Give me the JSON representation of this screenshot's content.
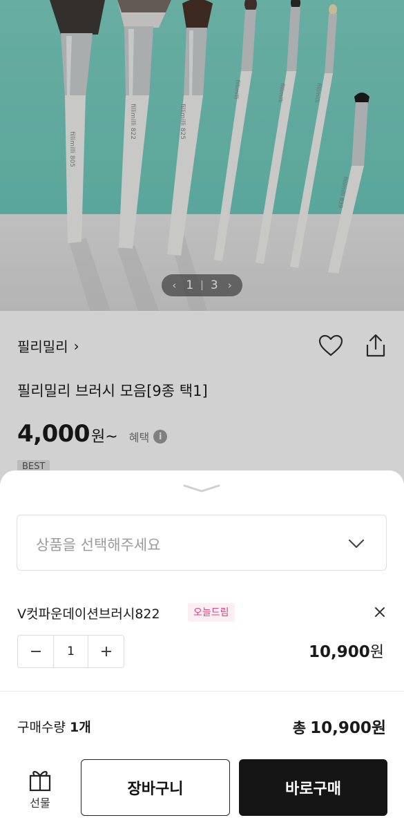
{
  "gallery": {
    "current_page": "1",
    "separator": "|",
    "total_pages": "3",
    "brush_brand_text": "fillimilli",
    "brush_numbers": [
      "805",
      "822",
      "825",
      "",
      "",
      "",
      "839"
    ]
  },
  "product": {
    "brand": "필리밀리",
    "title": "필리밀리 브러시 모음[9종 택1]",
    "price": "4,000",
    "price_unit": "원~",
    "benefit_label": "혜택",
    "benefit_icon": "i",
    "badge": "BEST"
  },
  "sheet": {
    "select_placeholder": "상품을 선택해주세요",
    "selected_option": {
      "name": "V컷파운데이션브러시822",
      "badge": "오늘드림",
      "quantity": "1",
      "price": "10,900",
      "price_unit": "원"
    },
    "summary": {
      "qty_label": "구매수량",
      "qty_value": "1개",
      "total_label": "총",
      "total_value": "10,900원"
    },
    "gift_label": "선물",
    "cart_label": "장바구니",
    "buy_label": "바로구매"
  },
  "colors": {
    "hero_background": "#6fcbbc",
    "badge_pink": "#d6457d",
    "buy_button": "#151515"
  },
  "icons": [
    "chevron-left-icon",
    "chevron-right-icon",
    "heart-icon",
    "share-icon",
    "chevron-down-icon",
    "close-icon",
    "minus-icon",
    "plus-icon",
    "gift-icon"
  ]
}
